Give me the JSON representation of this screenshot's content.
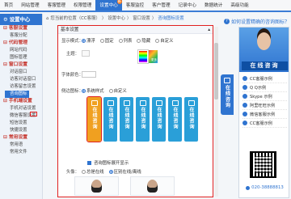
{
  "topnav": {
    "items": [
      "首页",
      "网站管理",
      "客服管理",
      "权限管理",
      "设置中心",
      "客服监控",
      "客户管理",
      "记录中心",
      "数据统计",
      "高级功能"
    ],
    "active_index": 4,
    "badge": "新"
  },
  "sidebar": {
    "title": "设置中心",
    "sections": [
      {
        "label": "客服设置",
        "items": [
          "客服分配"
        ]
      },
      {
        "label": "代码管理",
        "items": [
          "网站代码",
          "图标管理"
        ]
      },
      {
        "label": "窗口设置",
        "items": [
          "对话窗口",
          "访客对话窗口",
          "访客留言设置",
          "咨询图标"
        ]
      },
      {
        "label": "手机端设置",
        "items": [
          "手机对话设置",
          "微信客服设置",
          "短信设置",
          "快捷设置"
        ]
      },
      {
        "label": "常用设置",
        "items": [
          "常用语",
          "常用文件"
        ]
      }
    ],
    "active_item": "咨询图标"
  },
  "breadcrumb": [
    "您当前的位置（CC客服）",
    "设置中心",
    "窗口设置",
    "咨询图标设置"
  ],
  "panel": {
    "title": "基本设置",
    "collapse": "▴",
    "display_mode_label": "显示模式：",
    "display_modes": [
      "漂浮",
      "固定",
      "列表",
      "隐藏",
      "自定义"
    ],
    "theme_label": "主题：",
    "theme_color": "#f9f9f9",
    "picker_label": "更多",
    "font_size_label": "字体颜色：",
    "icon_label": "侧边图标：",
    "icon_modes": [
      "系统样式",
      "自定义"
    ],
    "icon_text": "在线咨询",
    "checkbox_label": "咨询图标展开显示",
    "head_label": "头像：",
    "head_modes": [
      "总是在线",
      "区别在线/离线"
    ]
  },
  "preview": {
    "question": "如何设置精确的咨询图标？",
    "tab_text": "在线咨询",
    "banner": "在线咨询",
    "items": [
      "CC客服示例",
      "Q Q示例",
      "Skype 示例",
      "阿里旺旺示例",
      "微信客服示例",
      "CC客服示例"
    ],
    "tel": "020-38888813"
  },
  "colors": {
    "accent": "#2f74d0",
    "highlight": "#e02020",
    "icon_blue": "#2a9fd8",
    "icon_orange": "#f0a020"
  }
}
